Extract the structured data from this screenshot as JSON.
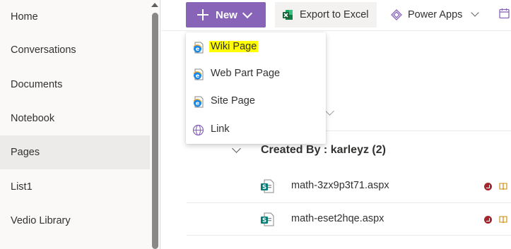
{
  "nav": {
    "items": [
      {
        "label": "Home"
      },
      {
        "label": "Conversations"
      },
      {
        "label": "Documents"
      },
      {
        "label": "Notebook"
      },
      {
        "label": "Pages",
        "selected": true
      },
      {
        "label": "List1"
      },
      {
        "label": "Vedio Library"
      }
    ]
  },
  "toolbar": {
    "new_label": "New",
    "export_label": "Export to Excel",
    "powerapps_label": "Power Apps"
  },
  "new_menu": {
    "items": [
      {
        "label": "Wiki Page",
        "icon": "ie-page-icon",
        "highlighted": true
      },
      {
        "label": "Web Part Page",
        "icon": "ie-page-icon"
      },
      {
        "label": "Site Page",
        "icon": "ie-page-icon"
      },
      {
        "label": "Link",
        "icon": "globe-icon"
      }
    ]
  },
  "list": {
    "group_header": "Created By : karleyz (2)",
    "rows": [
      {
        "name": "math-3zx9p3t71.aspx"
      },
      {
        "name": "math-eset2hqe.aspx"
      }
    ]
  },
  "colors": {
    "accent": "#8764b8",
    "highlight": "#ffff00",
    "status_red": "#a4262c"
  }
}
